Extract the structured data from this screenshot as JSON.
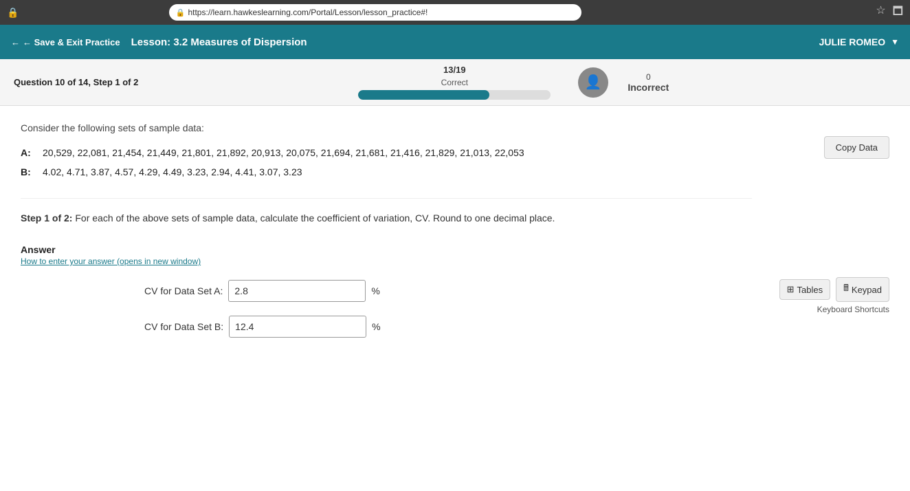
{
  "browser": {
    "url": "https://learn.hawkeslearning.com/Portal/Lesson/lesson_practice#!"
  },
  "header": {
    "back_label": "← Save & Exit Practice",
    "lesson_title": "Lesson: 3.2 Measures of Dispersion",
    "user_name": "JULIE ROMEO"
  },
  "progress": {
    "label": "13/19",
    "sublabel": "Correct",
    "fill_percent": 68,
    "incorrect_count": "0",
    "incorrect_label": "Incorrect"
  },
  "question": {
    "info": "Question 10 of 14,  Step 1 of 2"
  },
  "content": {
    "consider_text": "Consider the following sets of sample data:",
    "dataset_a_label": "A:",
    "dataset_a_values": "20,529, 22,081, 21,454, 21,449, 21,801, 21,892, 20,913, 20,075, 21,694, 21,681, 21,416, 21,829, 21,013, 22,053",
    "dataset_b_label": "B:",
    "dataset_b_values": "4.02, 4.71, 3.87, 4.57, 4.29, 4.49, 3.23, 2.94, 4.41, 3.07, 3.23",
    "step_text_bold": "Step 1 of 2:",
    "step_text_rest": "  For each of the above sets of sample data, calculate the coefficient of variation, CV. Round to one decimal place.",
    "answer_heading": "Answer",
    "answer_link": "How to enter your answer (opens in new window)",
    "cv_a_label": "CV for Data Set A:",
    "cv_a_value": "2.8",
    "cv_b_label": "CV for Data Set B:",
    "cv_b_value": "12.4",
    "percent_symbol": "%"
  },
  "sidebar": {
    "copy_data": "Copy Data",
    "tables_label": "Tables",
    "keypad_label": "Keypad",
    "keyboard_shortcuts": "Keyboard Shortcuts"
  },
  "icons": {
    "lock": "🔒",
    "back_arrow": "←",
    "table_icon": "⊞",
    "keypad_icon": "🖩",
    "avatar_icon": "👤",
    "dropdown_arrow": "▼"
  }
}
